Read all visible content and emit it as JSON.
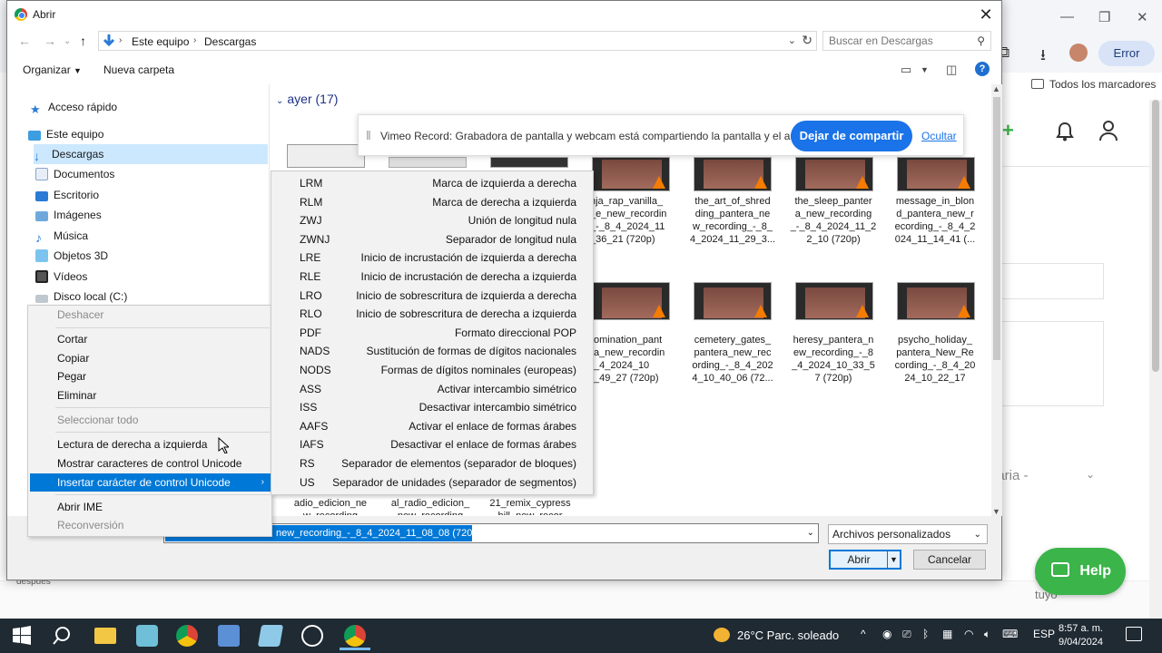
{
  "browser": {
    "error_label": "Error",
    "bookmarks_label": "Todos los marcadores",
    "select_hint": "daria -",
    "after_text": "despues",
    "help_label": "Help",
    "tuyo_text": "o e\ntuyo"
  },
  "dialog": {
    "title": "Abrir",
    "breadcrumb": [
      "Este equipo",
      "Descargas"
    ],
    "search_placeholder": "Buscar en Descargas",
    "organize_label": "Organizar",
    "new_folder_label": "Nueva carpeta",
    "nav_items": [
      {
        "label": "Acceso rápido",
        "icon": "star-icon"
      },
      {
        "label": "Este equipo",
        "icon": "computer-icon"
      },
      {
        "label": "Descargas",
        "icon": "download-icon",
        "selected": true
      },
      {
        "label": "Documentos",
        "icon": "document-icon"
      },
      {
        "label": "Escritorio",
        "icon": "desktop-icon"
      },
      {
        "label": "Imágenes",
        "icon": "pictures-icon"
      },
      {
        "label": "Música",
        "icon": "music-icon"
      },
      {
        "label": "Objetos 3D",
        "icon": "cube-icon"
      },
      {
        "label": "Vídeos",
        "icon": "video-icon"
      },
      {
        "label": "Disco local (C:)",
        "icon": "drive-icon"
      }
    ],
    "group_label": "ayer (17)",
    "files": [
      {
        "name": "nja_rap_vanilla_\n_e_new_recordin\n_-_8_4_2024_11\n_36_21 (720p)"
      },
      {
        "name": "the_art_of_shred\nding_pantera_ne\nw_recording_-_8_\n4_2024_11_29_3..."
      },
      {
        "name": "the_sleep_panter\na_new_recording\n_-_8_4_2024_11_2\n2_10 (720p)"
      },
      {
        "name": "message_in_blon\nd_pantera_new_r\necording_-_8_4_2\n024_11_14_41 (..."
      },
      {
        "name": "omination_pant\na_new_recordin\n_4_2024_10\n_49_27 (720p)"
      },
      {
        "name": "cemetery_gates_\npantera_new_rec\nording_-_8_4_202\n4_10_40_06 (72..."
      },
      {
        "name": "heresy_pantera_n\new_recording_-_8\n_4_2024_10_33_5\n7 (720p)"
      },
      {
        "name": "psycho_holiday_\npantera_New_Re\ncording_-_8_4_20\n24_10_22_17"
      },
      {
        "name": "adio_edicion_ne\nw_recording"
      },
      {
        "name": "al_radio_edicion_\nnew_recording"
      },
      {
        "name": "21_remix_cypress\nhill_new_recor"
      }
    ],
    "filename_value": "new_recording_-_8_4_2024_11_08_08 (720p)",
    "filetype_value": "Archivos personalizados",
    "open_label": "Abrir",
    "cancel_label": "Cancelar"
  },
  "share_bar": {
    "message": "Vimeo Record: Grabadora de pantalla y webcam está compartiendo la pantalla y el audio.",
    "stop_label": "Dejar de compartir",
    "hide_label": "Ocultar"
  },
  "context_menu": {
    "undo": "Deshacer",
    "cut": "Cortar",
    "copy": "Copiar",
    "paste": "Pegar",
    "delete": "Eliminar",
    "select_all": "Seleccionar todo",
    "rtl_reading": "Lectura de derecha a izquierda",
    "show_unicode": "Mostrar caracteres de control Unicode",
    "insert_unicode": "Insertar carácter de control Unicode",
    "open_ime": "Abrir IME",
    "reconversion": "Reconversión"
  },
  "unicode_menu": [
    {
      "code": "LRM",
      "desc": "Marca de izquierda a derecha"
    },
    {
      "code": "RLM",
      "desc": "Marca de derecha a izquierda"
    },
    {
      "code": "ZWJ",
      "desc": "Unión de longitud nula"
    },
    {
      "code": "ZWNJ",
      "desc": "Separador de longitud nula"
    },
    {
      "code": "LRE",
      "desc": "Inicio de incrustación de izquierda a derecha"
    },
    {
      "code": "RLE",
      "desc": "Inicio de incrustación de derecha a izquierda"
    },
    {
      "code": "LRO",
      "desc": "Inicio de sobrescritura de izquierda a derecha"
    },
    {
      "code": "RLO",
      "desc": "Inicio de sobrescritura de derecha a izquierda"
    },
    {
      "code": "PDF",
      "desc": "Formato direccional POP"
    },
    {
      "code": "NADS",
      "desc": "Sustitución de formas de dígitos nacionales"
    },
    {
      "code": "NODS",
      "desc": "Formas de dígitos nominales (europeas)"
    },
    {
      "code": "ASS",
      "desc": "Activar intercambio simétrico"
    },
    {
      "code": "ISS",
      "desc": "Desactivar intercambio simétrico"
    },
    {
      "code": "AAFS",
      "desc": "Activar el enlace de formas árabes"
    },
    {
      "code": "IAFS",
      "desc": "Desactivar el enlace de formas árabes"
    },
    {
      "code": "RS",
      "desc": "Separador de elementos (separador de bloques)"
    },
    {
      "code": "US",
      "desc": "Separador de unidades (separador de segmentos)"
    }
  ],
  "taskbar": {
    "weather": "26°C  Parc. soleado",
    "language": "ESP",
    "time": "8:57 a. m.",
    "date": "9/04/2024"
  }
}
